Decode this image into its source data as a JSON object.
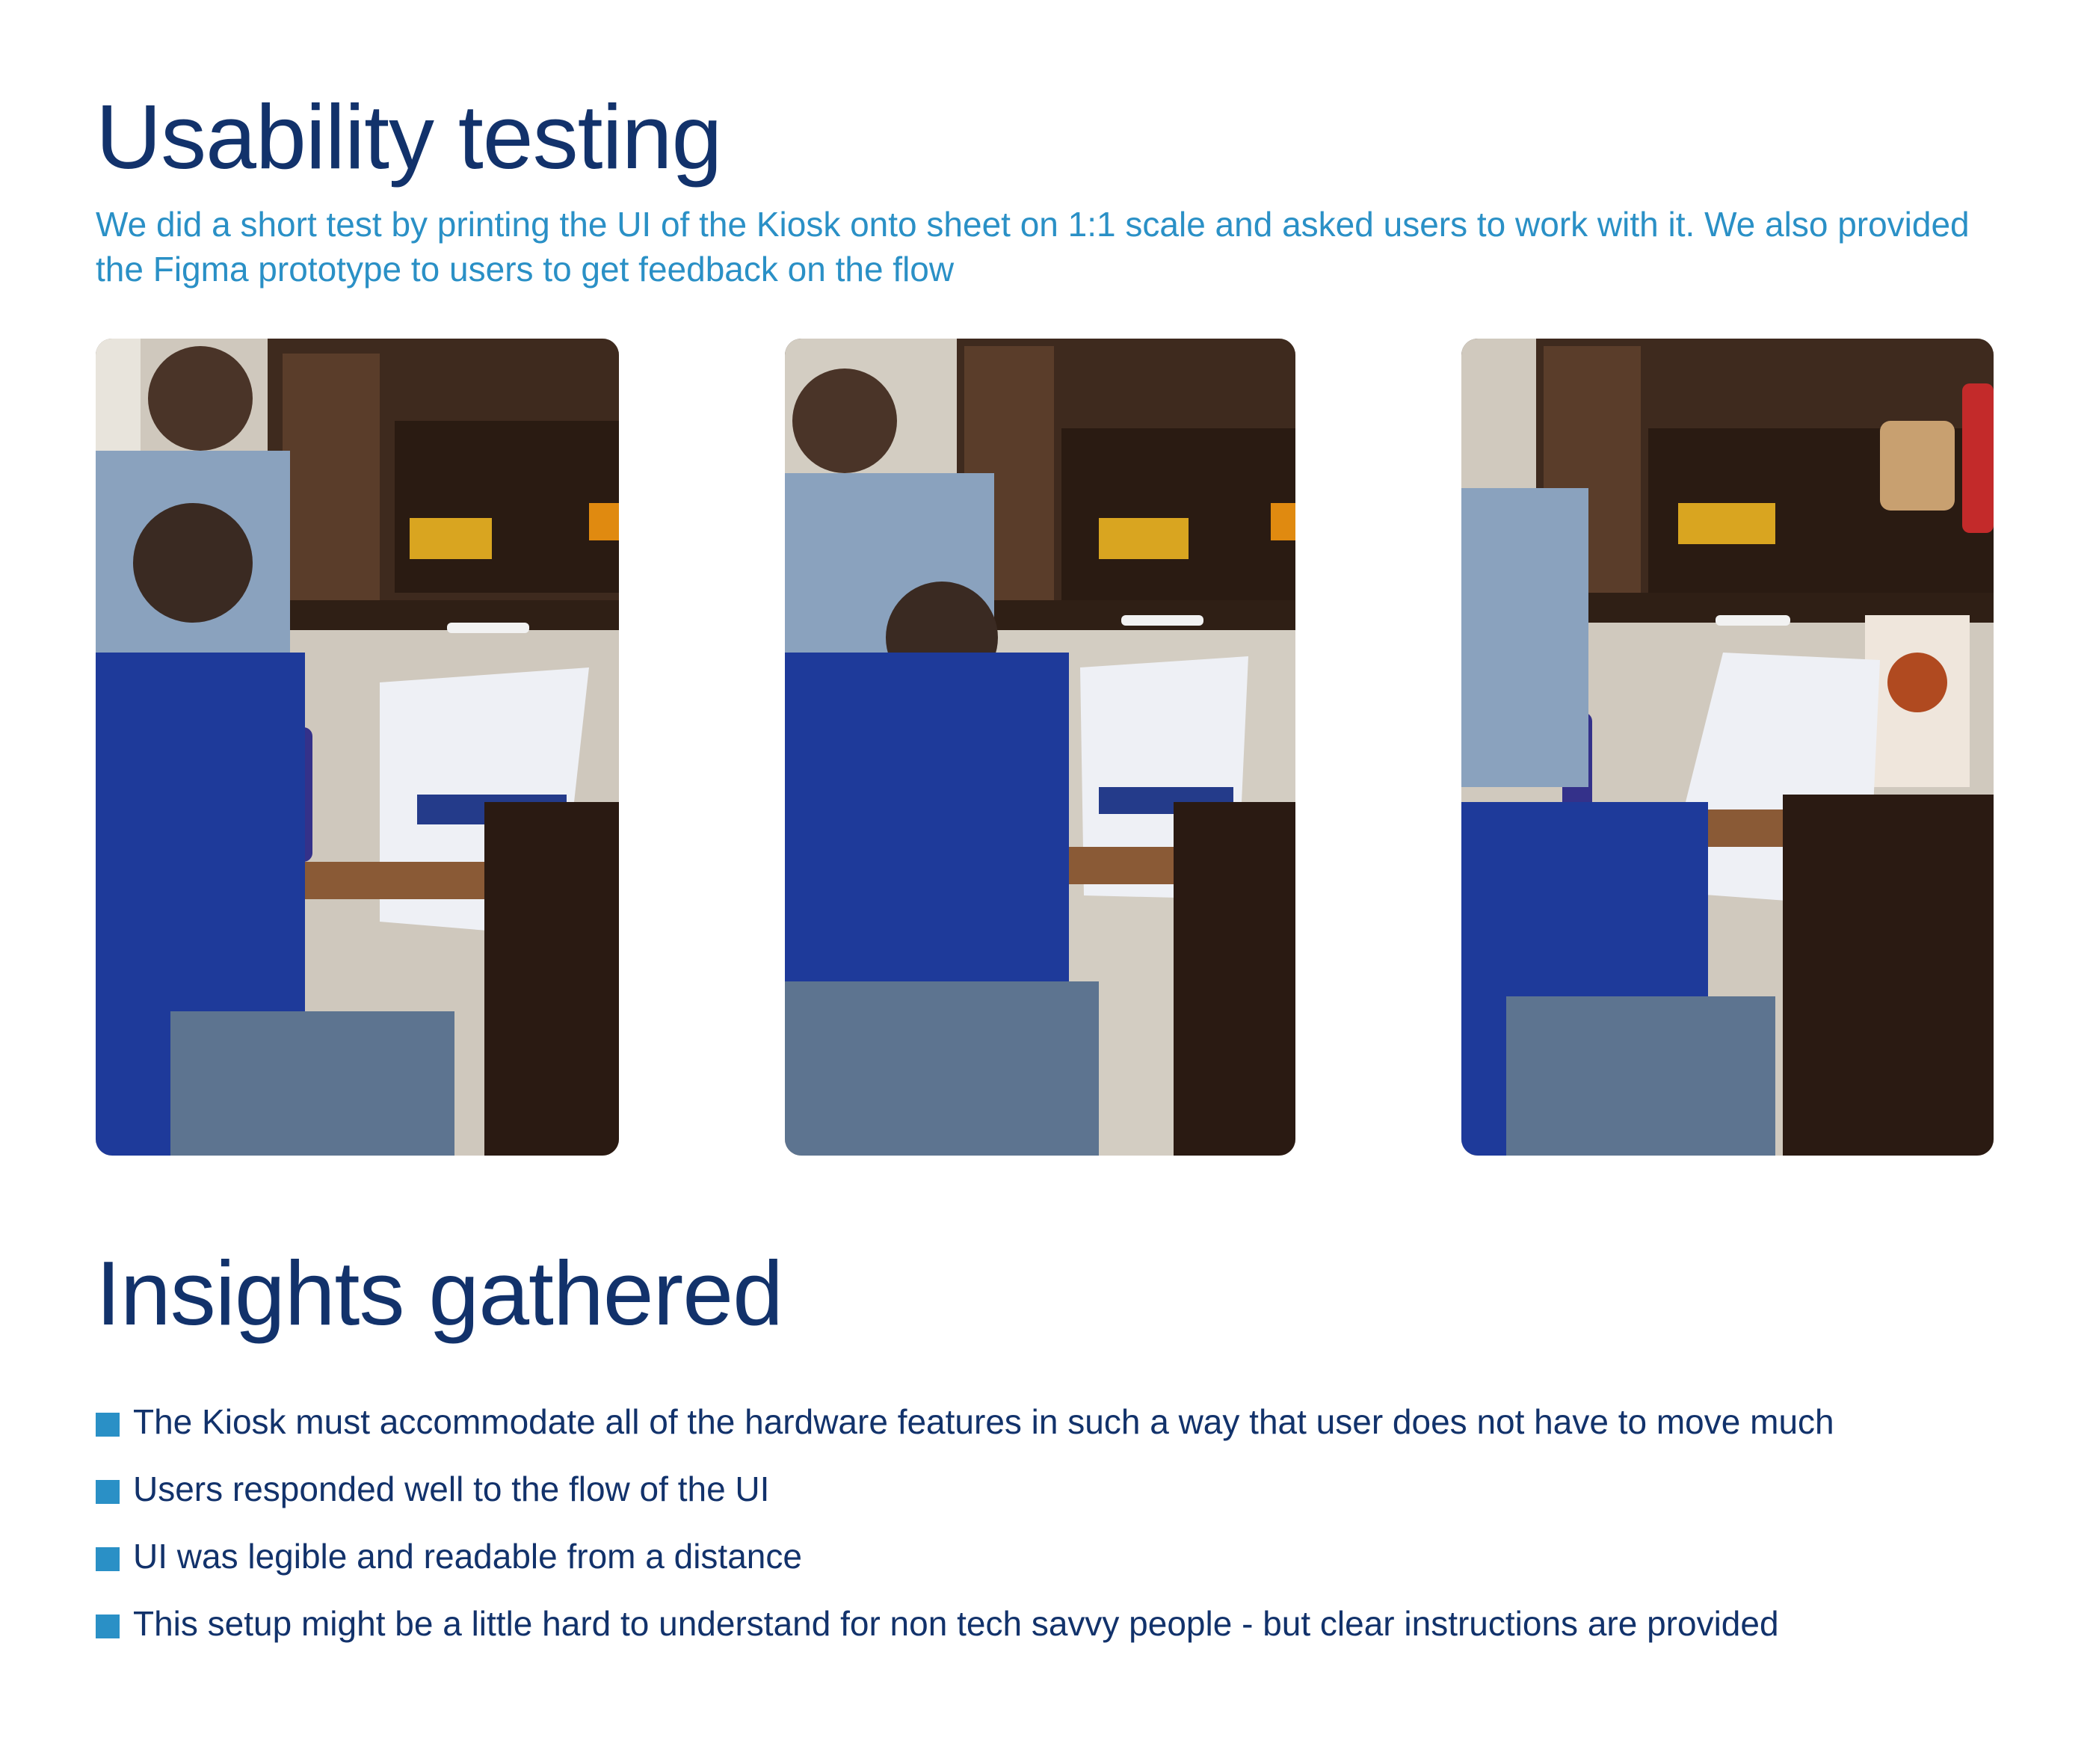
{
  "usability": {
    "title": "Usability testing",
    "description": "We did a short test by printing the UI of the Kiosk onto sheet on 1:1 scale and asked users to work with it. We also provided the Figma prototype to users to get feedback on the flow"
  },
  "photos": [
    {
      "icon": "usability-test-photo-1"
    },
    {
      "icon": "usability-test-photo-2"
    },
    {
      "icon": "usability-test-photo-3"
    }
  ],
  "insights": {
    "title": "Insights gathered",
    "items": [
      "The Kiosk must accommodate all of the hardware features in such a way that user does not have to move much",
      "Users responded well to the flow of the UI",
      "UI was legible and readable from a distance",
      "This setup might be a little hard to understand for non tech savvy people - but clear instructions are provided"
    ]
  },
  "colors": {
    "heading": "#12326b",
    "accent": "#2a90c6",
    "background": "#ffffff"
  }
}
